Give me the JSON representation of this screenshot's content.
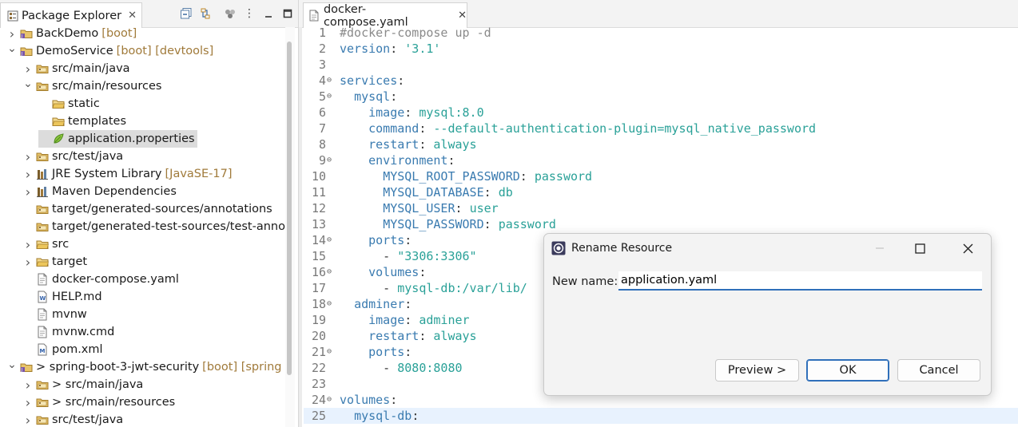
{
  "explorer": {
    "title": "Package Explorer",
    "items": [
      {
        "indent": 0,
        "chev": "right",
        "icon": "project",
        "name": "BackDemo",
        "deco": "[boot]"
      },
      {
        "indent": 0,
        "chev": "down",
        "icon": "project",
        "name": "DemoService",
        "deco": "[boot] [devtools]"
      },
      {
        "indent": 1,
        "chev": "right",
        "icon": "src-folder",
        "name": "src/main/java",
        "deco": ""
      },
      {
        "indent": 1,
        "chev": "down",
        "icon": "src-folder",
        "name": "src/main/resources",
        "deco": ""
      },
      {
        "indent": 2,
        "chev": "",
        "icon": "folder",
        "name": "static",
        "deco": ""
      },
      {
        "indent": 2,
        "chev": "",
        "icon": "folder",
        "name": "templates",
        "deco": ""
      },
      {
        "indent": 2,
        "chev": "",
        "icon": "properties",
        "name": "application.properties",
        "deco": "",
        "selected": true
      },
      {
        "indent": 1,
        "chev": "right",
        "icon": "src-folder",
        "name": "src/test/java",
        "deco": ""
      },
      {
        "indent": 1,
        "chev": "right",
        "icon": "library",
        "name": "JRE System Library",
        "deco": "[JavaSE-17]"
      },
      {
        "indent": 1,
        "chev": "right",
        "icon": "library",
        "name": "Maven Dependencies",
        "deco": ""
      },
      {
        "indent": 1,
        "chev": "",
        "icon": "src-folder",
        "name": "target/generated-sources/annotations",
        "deco": ""
      },
      {
        "indent": 1,
        "chev": "",
        "icon": "src-folder",
        "name": "target/generated-test-sources/test-anno",
        "deco": ""
      },
      {
        "indent": 1,
        "chev": "right",
        "icon": "folder",
        "name": "src",
        "deco": ""
      },
      {
        "indent": 1,
        "chev": "right",
        "icon": "folder",
        "name": "target",
        "deco": ""
      },
      {
        "indent": 1,
        "chev": "",
        "icon": "file",
        "name": "docker-compose.yaml",
        "deco": ""
      },
      {
        "indent": 1,
        "chev": "",
        "icon": "md",
        "name": "HELP.md",
        "deco": ""
      },
      {
        "indent": 1,
        "chev": "",
        "icon": "file",
        "name": "mvnw",
        "deco": ""
      },
      {
        "indent": 1,
        "chev": "",
        "icon": "file",
        "name": "mvnw.cmd",
        "deco": ""
      },
      {
        "indent": 1,
        "chev": "",
        "icon": "maven",
        "name": "pom.xml",
        "deco": ""
      },
      {
        "indent": 0,
        "chev": "down",
        "icon": "project",
        "name": "> spring-boot-3-jwt-security",
        "deco": "[boot] [spring"
      },
      {
        "indent": 1,
        "chev": "right",
        "icon": "src-folder",
        "name": "> src/main/java",
        "deco": ""
      },
      {
        "indent": 1,
        "chev": "right",
        "icon": "src-folder",
        "name": "> src/main/resources",
        "deco": ""
      },
      {
        "indent": 1,
        "chev": "right",
        "icon": "src-folder",
        "name": "src/test/java",
        "deco": ""
      }
    ]
  },
  "editor": {
    "tab_label": "docker-compose.yaml",
    "current_line": 25,
    "lines": [
      {
        "n": "1",
        "fold": false,
        "segs": [
          {
            "c": "cm",
            "t": "#docker-compose up -d"
          }
        ]
      },
      {
        "n": "2",
        "fold": false,
        "segs": [
          {
            "c": "k",
            "t": "version"
          },
          {
            "c": "p",
            "t": ": "
          },
          {
            "c": "v",
            "t": "'3.1'"
          }
        ]
      },
      {
        "n": "3",
        "fold": false,
        "segs": []
      },
      {
        "n": "4",
        "fold": true,
        "segs": [
          {
            "c": "k",
            "t": "services"
          },
          {
            "c": "p",
            "t": ":"
          }
        ]
      },
      {
        "n": "5",
        "fold": true,
        "segs": [
          {
            "c": "p",
            "t": "  "
          },
          {
            "c": "k",
            "t": "mysql"
          },
          {
            "c": "p",
            "t": ":"
          }
        ]
      },
      {
        "n": "6",
        "fold": false,
        "segs": [
          {
            "c": "p",
            "t": "    "
          },
          {
            "c": "k",
            "t": "image"
          },
          {
            "c": "p",
            "t": ": "
          },
          {
            "c": "v",
            "t": "mysql:8.0"
          }
        ]
      },
      {
        "n": "7",
        "fold": false,
        "segs": [
          {
            "c": "p",
            "t": "    "
          },
          {
            "c": "k",
            "t": "command"
          },
          {
            "c": "p",
            "t": ": "
          },
          {
            "c": "v",
            "t": "--default-authentication-plugin=mysql_native_password"
          }
        ]
      },
      {
        "n": "8",
        "fold": false,
        "segs": [
          {
            "c": "p",
            "t": "    "
          },
          {
            "c": "k",
            "t": "restart"
          },
          {
            "c": "p",
            "t": ": "
          },
          {
            "c": "v",
            "t": "always"
          }
        ]
      },
      {
        "n": "9",
        "fold": true,
        "segs": [
          {
            "c": "p",
            "t": "    "
          },
          {
            "c": "k",
            "t": "environment"
          },
          {
            "c": "p",
            "t": ":"
          }
        ]
      },
      {
        "n": "10",
        "fold": false,
        "segs": [
          {
            "c": "p",
            "t": "      "
          },
          {
            "c": "k",
            "t": "MYSQL_ROOT_PASSWORD"
          },
          {
            "c": "p",
            "t": ": "
          },
          {
            "c": "v",
            "t": "password"
          }
        ]
      },
      {
        "n": "11",
        "fold": false,
        "segs": [
          {
            "c": "p",
            "t": "      "
          },
          {
            "c": "k",
            "t": "MYSQL_DATABASE"
          },
          {
            "c": "p",
            "t": ": "
          },
          {
            "c": "v",
            "t": "db"
          }
        ]
      },
      {
        "n": "12",
        "fold": false,
        "segs": [
          {
            "c": "p",
            "t": "      "
          },
          {
            "c": "k",
            "t": "MYSQL_USER"
          },
          {
            "c": "p",
            "t": ": "
          },
          {
            "c": "v",
            "t": "user"
          }
        ]
      },
      {
        "n": "13",
        "fold": false,
        "segs": [
          {
            "c": "p",
            "t": "      "
          },
          {
            "c": "k",
            "t": "MYSQL_PASSWORD"
          },
          {
            "c": "p",
            "t": ": "
          },
          {
            "c": "v",
            "t": "password"
          }
        ]
      },
      {
        "n": "14",
        "fold": true,
        "segs": [
          {
            "c": "p",
            "t": "    "
          },
          {
            "c": "k",
            "t": "ports"
          },
          {
            "c": "p",
            "t": ":"
          }
        ]
      },
      {
        "n": "15",
        "fold": false,
        "segs": [
          {
            "c": "p",
            "t": "      - "
          },
          {
            "c": "v",
            "t": "\"3306:3306\""
          }
        ]
      },
      {
        "n": "16",
        "fold": true,
        "segs": [
          {
            "c": "p",
            "t": "    "
          },
          {
            "c": "k",
            "t": "volumes"
          },
          {
            "c": "p",
            "t": ":"
          }
        ]
      },
      {
        "n": "17",
        "fold": false,
        "segs": [
          {
            "c": "p",
            "t": "      - "
          },
          {
            "c": "v",
            "t": "mysql-db:/var/lib/"
          }
        ]
      },
      {
        "n": "18",
        "fold": true,
        "segs": [
          {
            "c": "p",
            "t": "  "
          },
          {
            "c": "k",
            "t": "adminer"
          },
          {
            "c": "p",
            "t": ":"
          }
        ]
      },
      {
        "n": "19",
        "fold": false,
        "segs": [
          {
            "c": "p",
            "t": "    "
          },
          {
            "c": "k",
            "t": "image"
          },
          {
            "c": "p",
            "t": ": "
          },
          {
            "c": "v",
            "t": "adminer"
          }
        ]
      },
      {
        "n": "20",
        "fold": false,
        "segs": [
          {
            "c": "p",
            "t": "    "
          },
          {
            "c": "k",
            "t": "restart"
          },
          {
            "c": "p",
            "t": ": "
          },
          {
            "c": "v",
            "t": "always"
          }
        ]
      },
      {
        "n": "21",
        "fold": true,
        "segs": [
          {
            "c": "p",
            "t": "    "
          },
          {
            "c": "k",
            "t": "ports"
          },
          {
            "c": "p",
            "t": ":"
          }
        ]
      },
      {
        "n": "22",
        "fold": false,
        "segs": [
          {
            "c": "p",
            "t": "      - "
          },
          {
            "c": "v",
            "t": "8080:8080"
          }
        ]
      },
      {
        "n": "23",
        "fold": false,
        "segs": []
      },
      {
        "n": "24",
        "fold": true,
        "segs": [
          {
            "c": "k",
            "t": "volumes"
          },
          {
            "c": "p",
            "t": ":"
          }
        ]
      },
      {
        "n": "25",
        "fold": false,
        "segs": [
          {
            "c": "p",
            "t": "  "
          },
          {
            "c": "k",
            "t": "mysql-db"
          },
          {
            "c": "p",
            "t": ":"
          }
        ]
      }
    ]
  },
  "dialog": {
    "title": "Rename Resource",
    "label": "New name:",
    "value": "application.yaml",
    "preview_label": "Preview >",
    "ok_label": "OK",
    "cancel_label": "Cancel"
  }
}
